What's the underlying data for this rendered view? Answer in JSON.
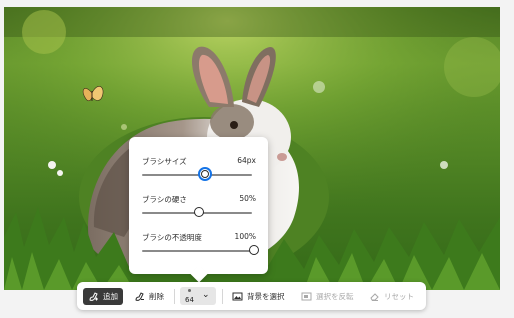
{
  "brush_panel": {
    "size": {
      "label": "ブラシサイズ",
      "value": "64px",
      "level": 0.55
    },
    "hardness": {
      "label": "ブラシの硬さ",
      "value": "50%",
      "level": 0.5
    },
    "opacity": {
      "label": "ブラシの不透明度",
      "value": "100%",
      "level": 1.0
    }
  },
  "toolbar": {
    "add_label": "追加",
    "remove_label": "削除",
    "brush_size_value": "64",
    "select_background_label": "背景を選択",
    "invert_selection_label": "選択を反転",
    "reset_label": "リセット"
  },
  "icons": {
    "add": "brush-plus-icon",
    "remove": "brush-minus-icon",
    "brush_size": "brush-size-dot-icon",
    "dropdown": "chevron-down-icon",
    "select_background": "image-select-icon",
    "invert": "invert-selection-icon",
    "reset": "eraser-reset-icon"
  },
  "colors": {
    "accent": "#1473e6",
    "active_button": "#3a3a3a"
  }
}
